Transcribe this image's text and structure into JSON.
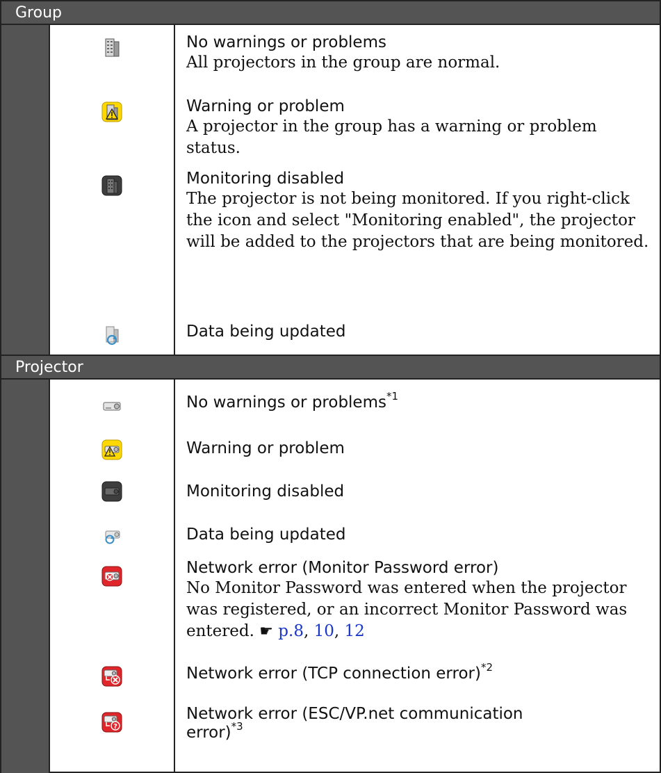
{
  "sections": {
    "group": {
      "header": "Group",
      "rows": [
        {
          "icon": "building-icon",
          "title": "No warnings or problems",
          "desc": "All projectors in the group are normal."
        },
        {
          "icon": "building-warning-icon",
          "title": "Warning or problem",
          "desc": "A projector in the group has a warning or problem status."
        },
        {
          "icon": "building-disabled-icon",
          "title": "Monitoring disabled",
          "desc": "The projector is not being monitored. If you right-click the icon and select \"Monitoring enabled\", the projector will be added to the projectors that are being monitored."
        },
        {
          "icon": "building-updating-icon",
          "title": "Data being updated",
          "desc": ""
        }
      ]
    },
    "projector": {
      "header": "Projector",
      "rows": [
        {
          "icon": "projector-icon",
          "title": "No warnings or problems",
          "sup": "*1"
        },
        {
          "icon": "projector-warning-icon",
          "title": "Warning or problem"
        },
        {
          "icon": "projector-disabled-icon",
          "title": "Monitoring disabled"
        },
        {
          "icon": "projector-updating-icon",
          "title": "Data being updated"
        },
        {
          "icon": "projector-password-error-icon",
          "title": "Network error (Monitor Password error)",
          "desc": "No Monitor Password was entered when the projector was registered, or an incorrect Monitor Password was entered.",
          "refs": [
            "p.8",
            "10",
            "12"
          ]
        },
        {
          "icon": "projector-tcp-error-icon",
          "title": "Network error (TCP connection error)",
          "sup": "*2"
        },
        {
          "icon": "projector-escvp-error-icon",
          "title_line1": "Network error (ESC/VP.net communication",
          "title_line2": "error)",
          "sup": "*3"
        }
      ]
    }
  },
  "colors": {
    "header_bg": "#545454",
    "page_bg": "#e3e6f7",
    "warning_yellow": "#ffd800",
    "error_red": "#e0262b",
    "link_blue": "#1a37c8"
  }
}
